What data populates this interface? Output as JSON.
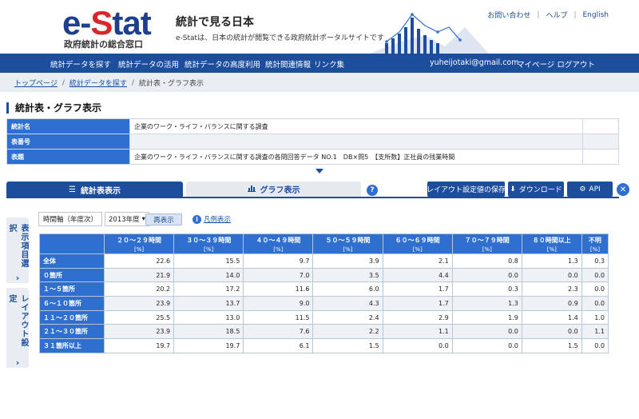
{
  "header": {
    "logo_main": "e-",
    "logo_accent": "S",
    "logo_rest": "tat",
    "logo_subtitle": "政府統計の総合窓口",
    "site_title": "統計で見る日本",
    "site_desc": "e-Statは、日本の統計が閲覧できる政府統計ポータルサイトです",
    "links": [
      "お問い合わせ",
      "ヘルプ",
      "English"
    ]
  },
  "nav": {
    "items": [
      "統計データを探す",
      "統計データの活用",
      "統計データの高度利用",
      "統計関連情報",
      "リンク集"
    ],
    "user_email": "yuheijotaki@gmail.com",
    "mypage": "マイページ",
    "logout": "ログアウト"
  },
  "breadcrumb": {
    "items": [
      "トップページ",
      "統計データを探す"
    ],
    "current": "統計表・グラフ表示"
  },
  "page_title": "統計表・グラフ表示",
  "info": {
    "rows": [
      {
        "key": "統計名",
        "value": "企業のワーク・ライフ・バランスに関する調査"
      },
      {
        "key": "表番号",
        "value": ""
      },
      {
        "key": "表題",
        "value": "企業のワーク・ライフ・バランスに関する調査の各問回答データ NO.1　DB×問5　【支所数】正社員の残業時間"
      }
    ]
  },
  "tabs": {
    "table": "統計表表示",
    "graph": "グラフ表示"
  },
  "help_label": "?",
  "buttons": {
    "save_layout": "レイアウト設定値の保存",
    "download": "ダウンロード",
    "api": "API"
  },
  "side_tabs": {
    "display_items": "表示項目選択",
    "layout": "レイアウト設定",
    "chevron": "›"
  },
  "controls": {
    "axis_label": "時間軸（年度次）",
    "axis_value": "2013年度",
    "redisplay": "再表示",
    "legend": "凡例表示"
  },
  "colors": {
    "nav": "#1d4e9e",
    "header_cell": "#2f6fd0",
    "row_alt": "#eef2f7"
  },
  "table": {
    "unit": "[%]",
    "columns": [
      "２０～２９時間",
      "３０～３９時間",
      "４０～４９時間",
      "５０～５９時間",
      "６０～６９時間",
      "７０～７９時間",
      "８０時間以上",
      "不明"
    ],
    "rows": [
      {
        "label": "全体",
        "values": [
          "22.6",
          "15.5",
          "9.7",
          "3.9",
          "2.1",
          "0.8",
          "1.3",
          "0.3"
        ]
      },
      {
        "label": "０箇所",
        "values": [
          "21.9",
          "14.0",
          "7.0",
          "3.5",
          "4.4",
          "0.0",
          "0.0",
          "0.0"
        ]
      },
      {
        "label": "１～５箇所",
        "values": [
          "20.2",
          "17.2",
          "11.6",
          "6.0",
          "1.7",
          "0.3",
          "2.3",
          "0.0"
        ]
      },
      {
        "label": "６～１０箇所",
        "values": [
          "23.9",
          "13.7",
          "9.0",
          "4.3",
          "1.7",
          "1.3",
          "0.9",
          "0.0"
        ]
      },
      {
        "label": "１１～２０箇所",
        "values": [
          "25.5",
          "13.0",
          "11.5",
          "2.4",
          "2.9",
          "1.9",
          "1.4",
          "1.0"
        ]
      },
      {
        "label": "２１～３０箇所",
        "values": [
          "23.9",
          "18.5",
          "7.6",
          "2.2",
          "1.1",
          "0.0",
          "0.0",
          "1.1"
        ]
      },
      {
        "label": "３１箇所以上",
        "values": [
          "19.7",
          "19.7",
          "6.1",
          "1.5",
          "0.0",
          "0.0",
          "1.5",
          "0.0"
        ]
      }
    ]
  }
}
